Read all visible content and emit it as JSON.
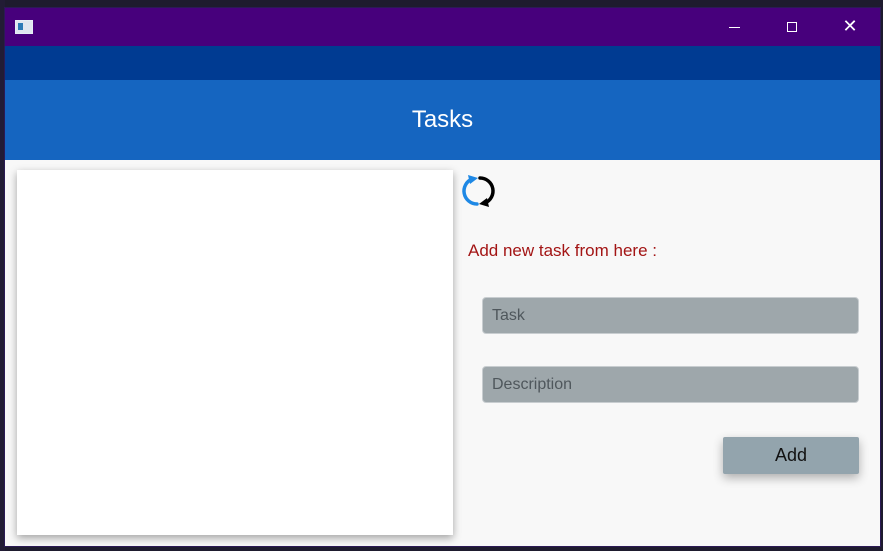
{
  "window": {
    "icon": "window-icon",
    "controls": {
      "minimize_icon": "minimize-icon",
      "maximize_icon": "maximize-icon",
      "close_label": "✕"
    }
  },
  "header": {
    "title": "Tasks"
  },
  "toolbar": {
    "refresh_icon": "refresh-icon"
  },
  "form": {
    "prompt": "Add new task from here :",
    "task": {
      "value": "",
      "placeholder": "Task"
    },
    "description": {
      "value": "",
      "placeholder": "Description"
    },
    "add_label": "Add"
  },
  "tasks": {
    "items": []
  },
  "colors": {
    "titlebar": "#47007c",
    "menubar": "#003b92",
    "header": "#1565c0",
    "prompt_text": "#a31515",
    "field_bg": "#9ea7ab",
    "button_bg": "#93a4ad",
    "refresh_blue": "#1e88e5"
  }
}
